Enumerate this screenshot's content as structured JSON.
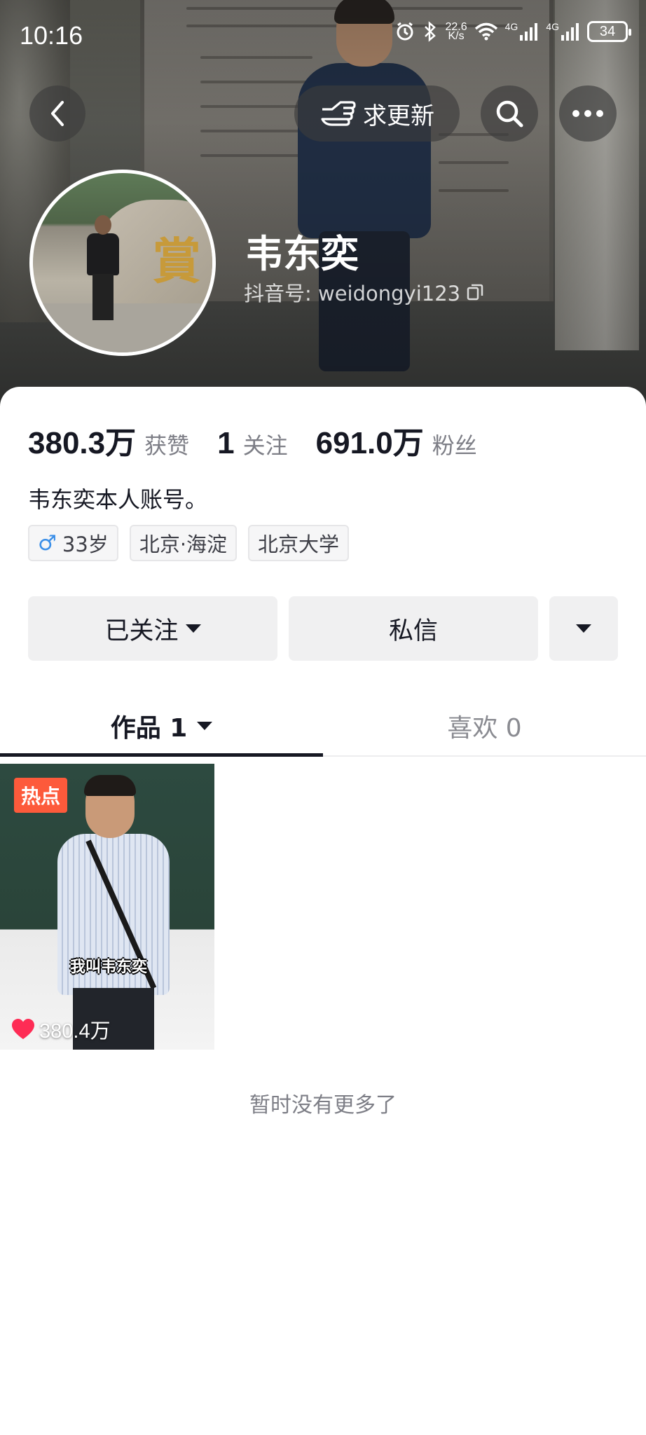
{
  "status_bar": {
    "time": "10:16",
    "net_speed_value": "22.6",
    "net_speed_unit": "K/s",
    "signal1": "4G",
    "signal2": "4G",
    "battery": "34"
  },
  "nav": {
    "update_label": "求更新"
  },
  "profile": {
    "name": "韦东奕",
    "douyin_id": "抖音号: weidongyi123"
  },
  "stats": [
    {
      "value": "380.3万",
      "label": "获赞"
    },
    {
      "value": "1",
      "label": "关注"
    },
    {
      "value": "691.0万",
      "label": "粉丝"
    }
  ],
  "bio": "韦东奕本人账号。",
  "tags": {
    "age": "33岁",
    "location": "北京·海淀",
    "school": "北京大学"
  },
  "actions": {
    "follow": "已关注",
    "message": "私信"
  },
  "tabs": {
    "works": "作品 1",
    "likes": "喜欢 0"
  },
  "video": {
    "badge": "热点",
    "caption": "我叫韦东奕",
    "likes": "380.4万"
  },
  "footer": {
    "no_more": "暂时没有更多了"
  },
  "colors": {
    "accent_red": "#fd5a3b",
    "heart": "#fe2c55",
    "male_blue": "#3b8fe8"
  }
}
